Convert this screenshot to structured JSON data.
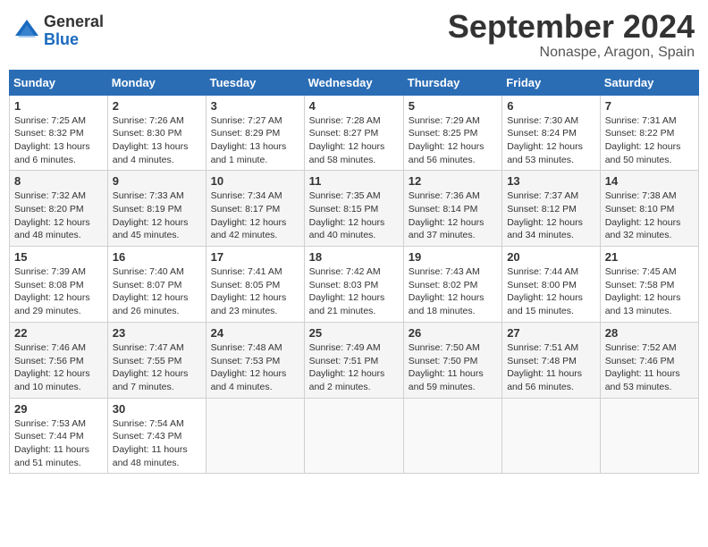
{
  "header": {
    "logo_general": "General",
    "logo_blue": "Blue",
    "title": "September 2024",
    "location": "Nonaspe, Aragon, Spain"
  },
  "calendar": {
    "days_of_week": [
      "Sunday",
      "Monday",
      "Tuesday",
      "Wednesday",
      "Thursday",
      "Friday",
      "Saturday"
    ],
    "weeks": [
      [
        null,
        {
          "day": "1",
          "sunrise": "7:25 AM",
          "sunset": "8:32 PM",
          "daylight": "13 hours and 6 minutes."
        },
        {
          "day": "2",
          "sunrise": "7:26 AM",
          "sunset": "8:30 PM",
          "daylight": "13 hours and 4 minutes."
        },
        {
          "day": "3",
          "sunrise": "7:27 AM",
          "sunset": "8:29 PM",
          "daylight": "13 hours and 1 minute."
        },
        {
          "day": "4",
          "sunrise": "7:28 AM",
          "sunset": "8:27 PM",
          "daylight": "12 hours and 58 minutes."
        },
        {
          "day": "5",
          "sunrise": "7:29 AM",
          "sunset": "8:25 PM",
          "daylight": "12 hours and 56 minutes."
        },
        {
          "day": "6",
          "sunrise": "7:30 AM",
          "sunset": "8:24 PM",
          "daylight": "12 hours and 53 minutes."
        },
        {
          "day": "7",
          "sunrise": "7:31 AM",
          "sunset": "8:22 PM",
          "daylight": "12 hours and 50 minutes."
        }
      ],
      [
        {
          "day": "8",
          "sunrise": "7:32 AM",
          "sunset": "8:20 PM",
          "daylight": "12 hours and 48 minutes."
        },
        {
          "day": "9",
          "sunrise": "7:33 AM",
          "sunset": "8:19 PM",
          "daylight": "12 hours and 45 minutes."
        },
        {
          "day": "10",
          "sunrise": "7:34 AM",
          "sunset": "8:17 PM",
          "daylight": "12 hours and 42 minutes."
        },
        {
          "day": "11",
          "sunrise": "7:35 AM",
          "sunset": "8:15 PM",
          "daylight": "12 hours and 40 minutes."
        },
        {
          "day": "12",
          "sunrise": "7:36 AM",
          "sunset": "8:14 PM",
          "daylight": "12 hours and 37 minutes."
        },
        {
          "day": "13",
          "sunrise": "7:37 AM",
          "sunset": "8:12 PM",
          "daylight": "12 hours and 34 minutes."
        },
        {
          "day": "14",
          "sunrise": "7:38 AM",
          "sunset": "8:10 PM",
          "daylight": "12 hours and 32 minutes."
        }
      ],
      [
        {
          "day": "15",
          "sunrise": "7:39 AM",
          "sunset": "8:08 PM",
          "daylight": "12 hours and 29 minutes."
        },
        {
          "day": "16",
          "sunrise": "7:40 AM",
          "sunset": "8:07 PM",
          "daylight": "12 hours and 26 minutes."
        },
        {
          "day": "17",
          "sunrise": "7:41 AM",
          "sunset": "8:05 PM",
          "daylight": "12 hours and 23 minutes."
        },
        {
          "day": "18",
          "sunrise": "7:42 AM",
          "sunset": "8:03 PM",
          "daylight": "12 hours and 21 minutes."
        },
        {
          "day": "19",
          "sunrise": "7:43 AM",
          "sunset": "8:02 PM",
          "daylight": "12 hours and 18 minutes."
        },
        {
          "day": "20",
          "sunrise": "7:44 AM",
          "sunset": "8:00 PM",
          "daylight": "12 hours and 15 minutes."
        },
        {
          "day": "21",
          "sunrise": "7:45 AM",
          "sunset": "7:58 PM",
          "daylight": "12 hours and 13 minutes."
        }
      ],
      [
        {
          "day": "22",
          "sunrise": "7:46 AM",
          "sunset": "7:56 PM",
          "daylight": "12 hours and 10 minutes."
        },
        {
          "day": "23",
          "sunrise": "7:47 AM",
          "sunset": "7:55 PM",
          "daylight": "12 hours and 7 minutes."
        },
        {
          "day": "24",
          "sunrise": "7:48 AM",
          "sunset": "7:53 PM",
          "daylight": "12 hours and 4 minutes."
        },
        {
          "day": "25",
          "sunrise": "7:49 AM",
          "sunset": "7:51 PM",
          "daylight": "12 hours and 2 minutes."
        },
        {
          "day": "26",
          "sunrise": "7:50 AM",
          "sunset": "7:50 PM",
          "daylight": "11 hours and 59 minutes."
        },
        {
          "day": "27",
          "sunrise": "7:51 AM",
          "sunset": "7:48 PM",
          "daylight": "11 hours and 56 minutes."
        },
        {
          "day": "28",
          "sunrise": "7:52 AM",
          "sunset": "7:46 PM",
          "daylight": "11 hours and 53 minutes."
        }
      ],
      [
        {
          "day": "29",
          "sunrise": "7:53 AM",
          "sunset": "7:44 PM",
          "daylight": "11 hours and 51 minutes."
        },
        {
          "day": "30",
          "sunrise": "7:54 AM",
          "sunset": "7:43 PM",
          "daylight": "11 hours and 48 minutes."
        },
        null,
        null,
        null,
        null,
        null
      ]
    ]
  }
}
